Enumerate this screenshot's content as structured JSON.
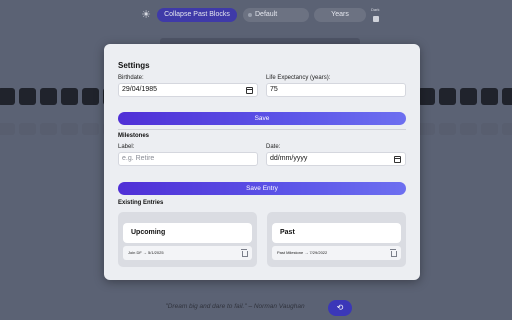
{
  "toolbar": {
    "theme_icon": "sun-icon",
    "collapse_label": "Collapse Past Blocks",
    "theme_label": "Default",
    "units_label": "Years",
    "dark_label": "Dark"
  },
  "quote": {
    "text": "\"Dream big and dare to fail.\" – Norman Vaughan",
    "refresh_icon": "refresh-icon"
  },
  "settings": {
    "title": "Settings",
    "birthdate_label": "Birthdate:",
    "birthdate_value": "29/04/1985",
    "life_expectancy_label": "Life Expectancy (years):",
    "life_expectancy_value": "75",
    "save_label": "Save",
    "milestones_title": "Milestones",
    "label_field_label": "Label:",
    "label_placeholder": "e.g. Retire",
    "date_field_label": "Date:",
    "date_placeholder": "dd/mm/yyyy",
    "save_entry_label": "Save Entry",
    "existing_title": "Existing Entries",
    "upcoming": {
      "title": "Upcoming",
      "entries": [
        {
          "text": "Join DF → 5/1/2025"
        }
      ]
    },
    "past": {
      "title": "Past",
      "entries": [
        {
          "text": "Past Milestone → 7/29/2022"
        }
      ]
    }
  },
  "colors": {
    "accent": "#4f2fd6",
    "overlay": "#5b6274",
    "modal_bg": "#eceef2"
  }
}
